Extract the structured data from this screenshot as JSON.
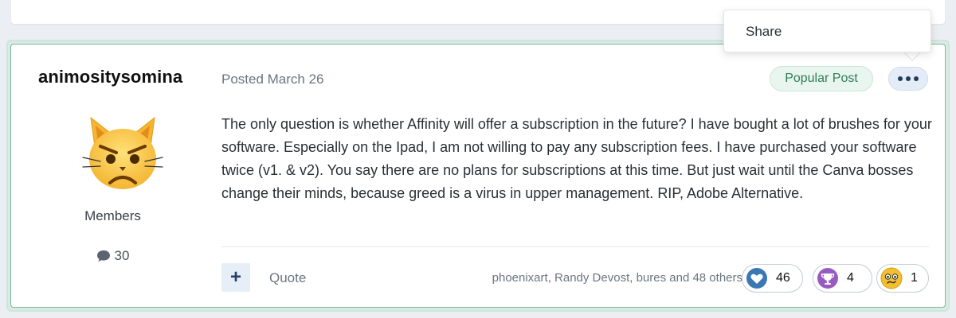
{
  "post": {
    "author": {
      "name": "animositysomina",
      "group": "Members",
      "post_count": "30",
      "avatar_icon": "pouting-cat-face-icon"
    },
    "posted_label": "Posted March 26",
    "badge": "Popular Post",
    "content": "The only question is whether Affinity will offer a subscription in the future? I have bought a lot of brushes for your software. Especially on the Ipad, I am not willing to pay any subscription fees. I have purchased your software twice (v1. & v2). You say there are no plans for subscriptions at this time. But just wait until the Canva bosses change their minds, because greed is a virus in upper management. RIP, Adobe Alternative.",
    "actions": {
      "multiquote_label": "+",
      "quote_label": "Quote"
    },
    "reactions_summary": "phoenixart, Randy Devost, bures and 48 others",
    "reactions": [
      {
        "icon": "like-heart-icon",
        "count": "46",
        "color": "#3b77b5"
      },
      {
        "icon": "trophy-icon",
        "count": "4",
        "color": "#9a5bc0"
      },
      {
        "icon": "confused-face-icon",
        "count": "1",
        "color": "#f2c02f"
      }
    ]
  },
  "menu": {
    "items": [
      "Share"
    ]
  },
  "colors": {
    "popular_bg": "#e9f5ef",
    "popular_text": "#2f7e58",
    "post_border": "#7fb49d",
    "action_button_bg": "#e6eef8"
  }
}
